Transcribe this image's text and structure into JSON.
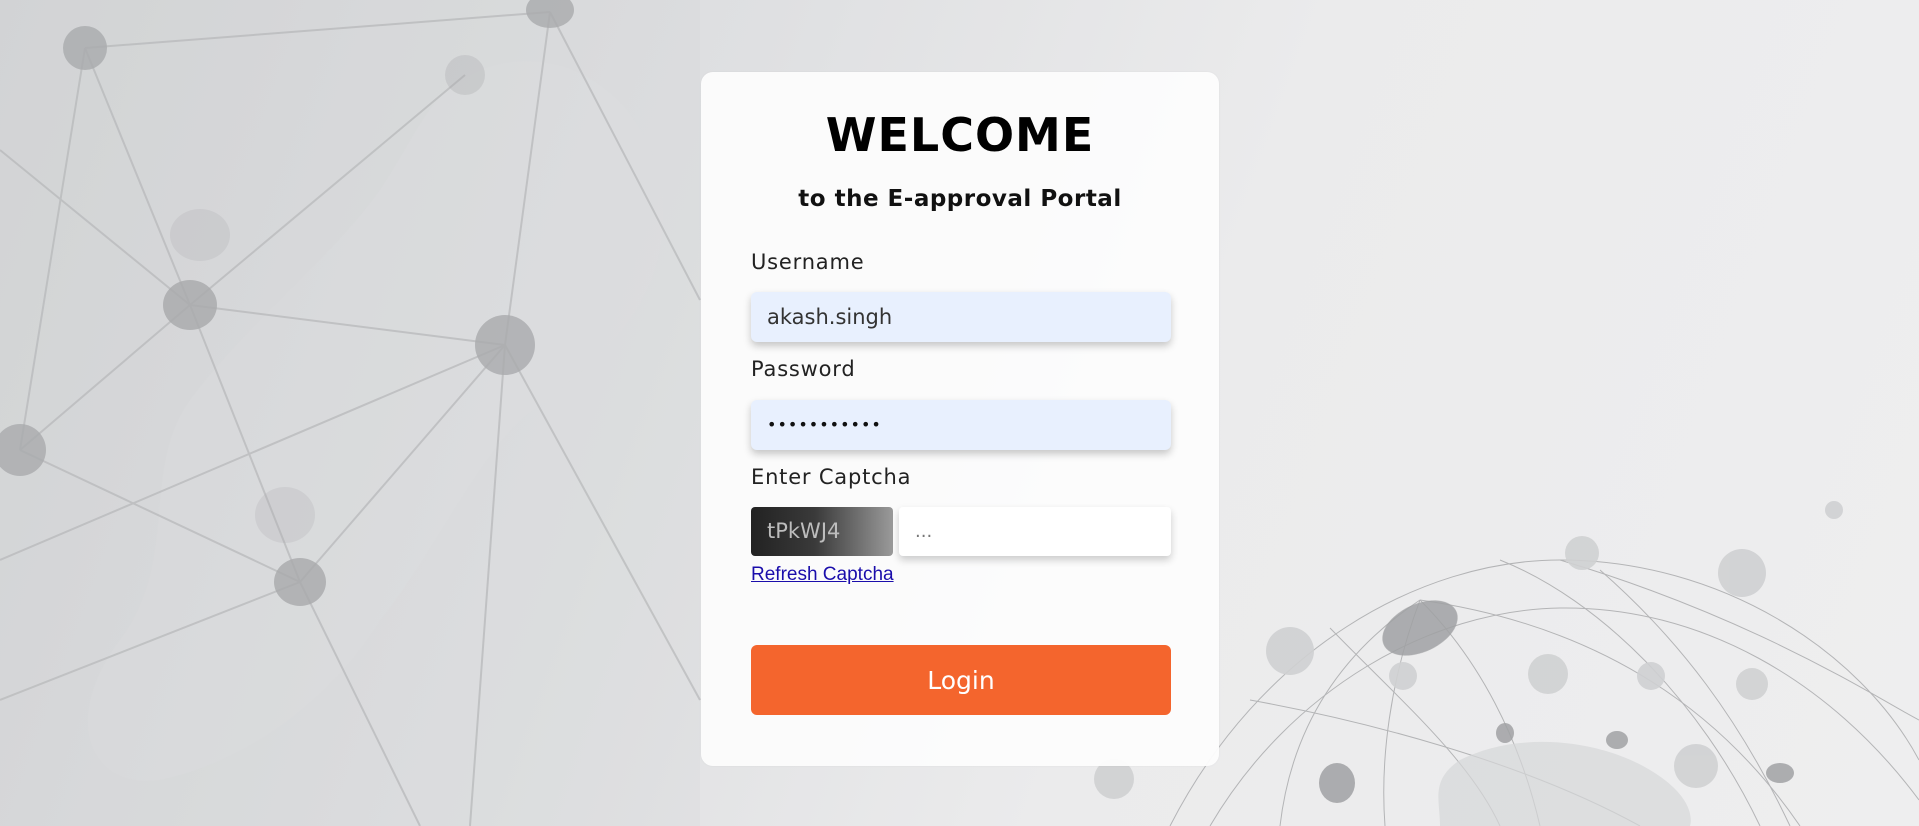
{
  "header": {
    "title": "WELCOME",
    "subtitle": "to the E-approval Portal"
  },
  "form": {
    "username_label": "Username",
    "username_value": "akash.singh",
    "password_label": "Password",
    "password_value": "•••••••••••",
    "captcha_label": "Enter Captcha",
    "captcha_code": "tPkWJ4",
    "captcha_placeholder": "...",
    "refresh_link": "Refresh Captcha",
    "login_label": "Login"
  },
  "colors": {
    "accent": "#f4652d",
    "input_bg": "#e8f0fe",
    "link": "#1a0dab"
  }
}
